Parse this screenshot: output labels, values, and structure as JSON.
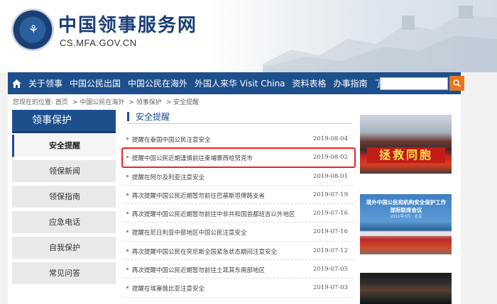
{
  "site": {
    "title": "中国领事服务网",
    "url": "CS.MFA.GOV.CN"
  },
  "nav": {
    "items": [
      "关于领事",
      "中国公民出国",
      "中国公民在海外",
      "外国人来华 Visit China",
      "资料表格",
      "办事指南",
      "了解目的地"
    ],
    "search_placeholder": ""
  },
  "breadcrumb": [
    "您现在的位置: 首页",
    "中国公民在海外",
    "领事保护",
    "安全提醒"
  ],
  "sidebar": {
    "title": "领事保护",
    "items": [
      "安全提醒",
      "领保新闻",
      "领保指南",
      "应急电话",
      "自我保护",
      "常见问答"
    ]
  },
  "main": {
    "heading": "安全提醒",
    "list": [
      {
        "title": "提醒在泰国中国公民注意安全",
        "date": "2019-08-04"
      },
      {
        "title": "提醒中国公民近期谨慎前往柬埔寨西哈努克市",
        "date": "2019-08-02"
      },
      {
        "title": "提醒在阿尔及利亚注意安全",
        "date": "2019-08-01"
      },
      {
        "title": "再次提醒中国公民近期暂勿前往巴基斯坦俾路支省",
        "date": "2019-07-19"
      },
      {
        "title": "再次提醒中国公民近期暂勿前往中非共和国首都班吉以外地区",
        "date": "2019-07-16"
      },
      {
        "title": "提醒在尼日利亚中部地区中国公民注意安全",
        "date": "2019-07-16"
      },
      {
        "title": "再次提醒中国公民在突尼斯全国紧急状态期间注意安全",
        "date": "2019-07-12"
      },
      {
        "title": "再次提醒中国公民近期暂勿前往土耳其东南部地区",
        "date": "2019-07-05"
      },
      {
        "title": "提醒在埃塞俄比亚注意安全",
        "date": "2019-07-03"
      }
    ]
  },
  "photos": {
    "banner_text": "拯救同胞",
    "meeting_title": "境外中国公民和机构安全保护工作部际联席会议",
    "meeting_sub": "2011年3月 · 北京"
  },
  "colors": {
    "nav_bg": "#1d4f8c",
    "search_btn": "#e8761c",
    "highlight": "#e22222"
  }
}
